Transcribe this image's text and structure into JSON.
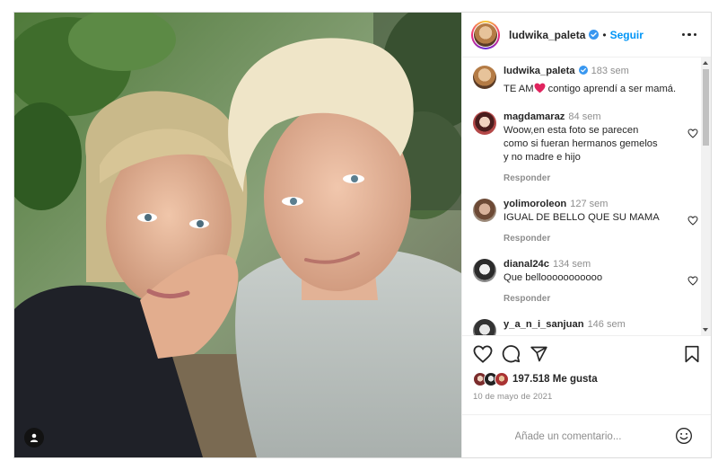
{
  "post": {
    "username": "ludwika_paleta",
    "follow_label": "Seguir",
    "separator": "•",
    "caption": {
      "username": "ludwika_paleta",
      "time": "183 sem",
      "text_before": "TE AM",
      "text_after": " contigo aprendí a ser mamá."
    },
    "comments": [
      {
        "username": "magdamaraz",
        "time": "84 sem",
        "text": "Woow,en esta foto se parecen como si fueran hermanos gemelos y no madre e hijo",
        "reply_label": "Responder"
      },
      {
        "username": "yolimoroleon",
        "time": "127 sem",
        "text": "IGUAL DE BELLO QUE SU MAMA",
        "reply_label": "Responder"
      },
      {
        "username": "dianal24c",
        "time": "134 sem",
        "text": "Que bellooooooooooo",
        "reply_label": "Responder"
      },
      {
        "username": "y_a_n_i_sanjuan",
        "time": "146 sem",
        "text": "",
        "reply_label": ""
      }
    ],
    "likes_count": "197.518",
    "likes_label": "Me gusta",
    "date": "10 de mayo de 2021",
    "comment_placeholder": "Añade un comentario..."
  },
  "icons": {
    "verified": "verified-badge-icon",
    "more": "more-options-icon",
    "like": "heart-icon",
    "comment": "comment-icon",
    "share": "share-icon",
    "save": "bookmark-icon",
    "emoji": "emoji-icon",
    "tag": "user-tag-icon"
  },
  "colors": {
    "accent": "#0095f6",
    "verified": "#3897f0",
    "heart": "#ed4956",
    "text": "#262626",
    "muted": "#8e8e8e"
  }
}
